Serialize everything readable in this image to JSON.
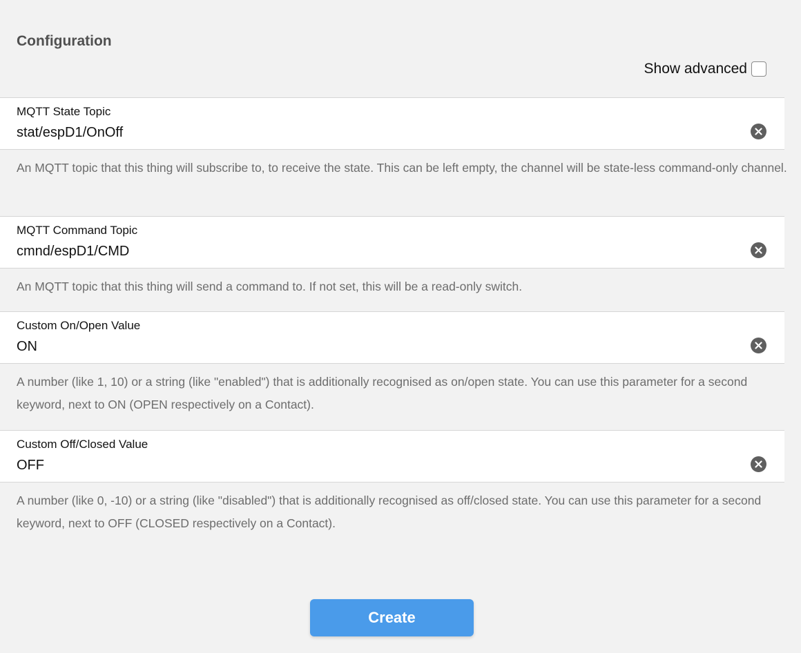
{
  "section": {
    "title": "Configuration"
  },
  "advanced": {
    "label": "Show advanced",
    "checked": false
  },
  "fields": [
    {
      "label": "MQTT State Topic",
      "value": "stat/espD1/OnOff",
      "description": "An MQTT topic that this thing will subscribe to, to receive the state. This can be left empty, the channel will be state-less command-only channel."
    },
    {
      "label": "MQTT Command Topic",
      "value": "cmnd/espD1/CMD",
      "description": "An MQTT topic that this thing will send a command to. If not set, this will be a read-only switch."
    },
    {
      "label": "Custom On/Open Value",
      "value": "ON",
      "description": "A number (like 1, 10) or a string (like \"enabled\") that is additionally recognised as on/open state. You can use this parameter for a second keyword, next to ON (OPEN respectively on a Contact)."
    },
    {
      "label": "Custom Off/Closed Value",
      "value": "OFF",
      "description": "A number (like 0, -10) or a string (like \"disabled\") that is additionally recognised as off/closed state. You can use this parameter for a second keyword, next to OFF (CLOSED respectively on a Contact)."
    }
  ],
  "icons": {
    "clear": "clear-circle-icon"
  },
  "actions": {
    "create_label": "Create"
  },
  "colors": {
    "accent": "#4a9bea",
    "background": "#f2f2f2",
    "clear_icon": "#5f5f5f"
  }
}
